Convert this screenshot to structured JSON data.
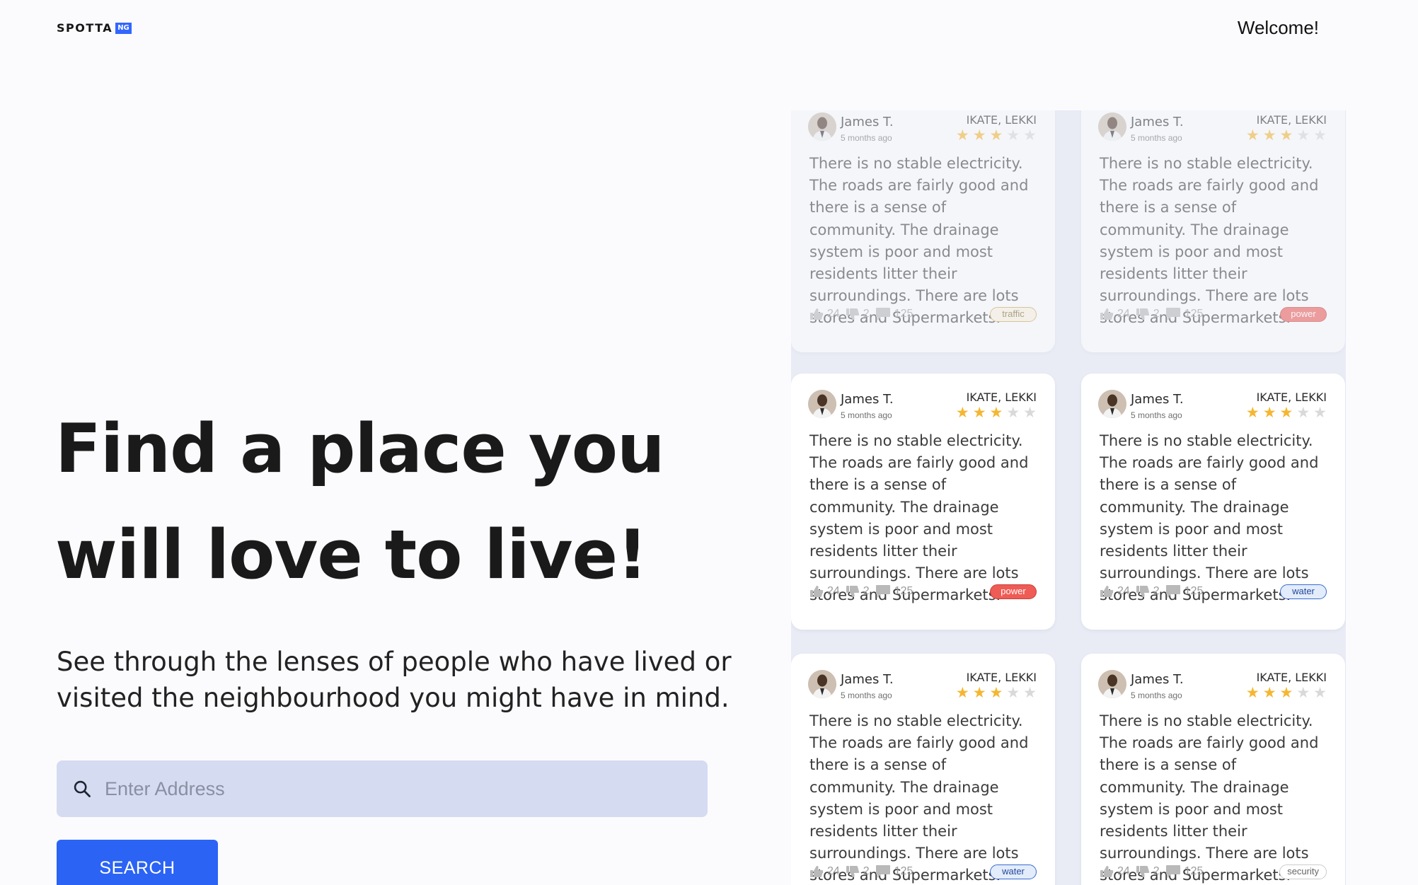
{
  "header": {
    "logo_text": "SPOTTA",
    "logo_badge": "NG",
    "welcome": "Welcome!"
  },
  "hero": {
    "title": "Find a place you will love to live!",
    "subtitle": "See through the lenses of people who have lived or visited the neighbourhood you might have in mind.",
    "search_placeholder": "Enter Address",
    "search_button": "SEARCH"
  },
  "reviews": [
    {
      "name": "James T.",
      "time": "5 months ago",
      "location": "IKATE, LEKKI",
      "rating": 3,
      "text": "There is no stable electricity. The roads are fairly good and there is a sense of community. The drainage system is poor and most residents litter their surroundings. There are lots stores and Supermarkets.",
      "likes": "24",
      "dislikes": "2",
      "comments": "125",
      "tag": "traffic"
    },
    {
      "name": "James T.",
      "time": "5 months ago",
      "location": "IKATE, LEKKI",
      "rating": 3,
      "text": "There is no stable electricity. The roads are fairly good and there is a sense of community. The drainage system is poor and most residents litter their surroundings. There are lots stores and Supermarkets.",
      "likes": "24",
      "dislikes": "2",
      "comments": "125",
      "tag": "power"
    },
    {
      "name": "James T.",
      "time": "5 months ago",
      "location": "IKATE, LEKKI",
      "rating": 3,
      "text": "There is no stable electricity. The roads are fairly good and there is a sense of community. The drainage system is poor and most residents litter their surroundings. There are lots stores and Supermarkets.",
      "likes": "24",
      "dislikes": "2",
      "comments": "125",
      "tag": "power"
    },
    {
      "name": "James T.",
      "time": "5 months ago",
      "location": "IKATE, LEKKI",
      "rating": 3,
      "text": "There is no stable electricity. The roads are fairly good and there is a sense of community. The drainage system is poor and most residents litter their surroundings. There are lots stores and Supermarkets.",
      "likes": "24",
      "dislikes": "2",
      "comments": "125",
      "tag": "water"
    },
    {
      "name": "James T.",
      "time": "5 months ago",
      "location": "IKATE, LEKKI",
      "rating": 3,
      "text": "There is no stable electricity. The roads are fairly good and there is a sense of community. The drainage system is poor and most residents litter their surroundings. There are lots stores and Supermarkets.",
      "likes": "24",
      "dislikes": "2",
      "comments": "125",
      "tag": "water"
    },
    {
      "name": "James T.",
      "time": "5 months ago",
      "location": "IKATE, LEKKI",
      "rating": 3,
      "text": "There is no stable electricity. The roads are fairly good and there is a sense of community. The drainage system is poor and most residents litter their surroundings. There are lots stores and Supermarkets.",
      "likes": "24",
      "dislikes": "2",
      "comments": "125",
      "tag": "security"
    }
  ],
  "colors": {
    "accent": "#2b63f5",
    "search_bg": "#d5dbf1",
    "star_on": "#f5b630",
    "star_off": "#d9d9d9",
    "tag_power": "#ef5b55",
    "tag_water": "#3a6bd0",
    "tag_traffic": "#c7a650"
  },
  "icons": {
    "search": "search-icon",
    "like": "thumbs-up-icon",
    "dislike": "thumbs-down-icon",
    "comment": "comment-icon"
  }
}
